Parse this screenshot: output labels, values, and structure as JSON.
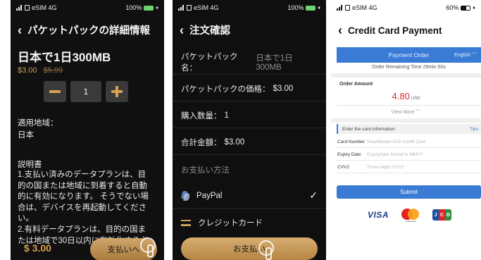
{
  "screen1": {
    "status": {
      "carrier": "eSIM 4G",
      "battery": "100%"
    },
    "header": {
      "title": "パケットパックの詳細情報"
    },
    "product": {
      "title": "日本で1日300MB",
      "price": "$3.00",
      "original_price": "$5.99"
    },
    "quantity": 1,
    "region_label": "適用地域：",
    "region_value": "日本",
    "description_label": "説明書",
    "description_lines": [
      "1.支払い済みのデータプランは、目",
      "的の国または地域に到着すると自動",
      "的に有効になります。 そうでない場",
      "合は、デバイスを再起動してくださ",
      "い。",
      "2.有料データプランは、目的の国ま",
      "たは地域で30日以内に有効化する必"
    ],
    "footer": {
      "total": "$ 3.00",
      "pay_button": "支払いへ"
    }
  },
  "screen2": {
    "status": {
      "carrier": "eSIM 4G",
      "battery": "100%"
    },
    "header": {
      "title": "注文確認"
    },
    "rows": [
      {
        "label": "パケットパック名：",
        "value": "日本で1日300MB"
      },
      {
        "label": "パケットパックの価格：",
        "value": "$3.00"
      },
      {
        "label": "購入数量：",
        "value": "1"
      },
      {
        "label": "合計金額：",
        "value": "$3.00"
      }
    ],
    "payment_section_title": "お支払い方法",
    "payment_methods": [
      {
        "label": "PayPal",
        "icon": "paypal-icon",
        "selected": true
      },
      {
        "label": "クレジットカード",
        "icon": "card-icon",
        "selected": false
      }
    ],
    "pay_button": "お支払い"
  },
  "screen3": {
    "status": {
      "carrier": "eSIM 4G",
      "battery": "60%"
    },
    "header": {
      "title": "Credit Card Payment"
    },
    "payment_order": {
      "title": "Payment Order",
      "language": "English"
    },
    "remaining_time": "Order Remaining Time 29min 50s",
    "order_amount": {
      "label": "Order Amount",
      "value": "4.80",
      "currency": "USD"
    },
    "view_more": "View More",
    "card_section": {
      "title": "Enter the card information",
      "tips": "Tips"
    },
    "fields": [
      {
        "label": "Card Number",
        "placeholder": "Visa/Master/JCB Credit Card"
      },
      {
        "label": "Expiry Date",
        "placeholder": "ExpiryDate format is MMYY"
      },
      {
        "label": "CVV2",
        "placeholder": "Three digits CVV2"
      }
    ],
    "submit_button": "Submit",
    "card_brands": {
      "visa": "VISA",
      "mastercard": "mastercard",
      "jcb": [
        "J",
        "C",
        "B"
      ]
    }
  },
  "colors": {
    "gold_accent": "#d9a253",
    "dark_bg": "#101010",
    "blue_accent": "#3a7bd5",
    "amount_red": "#d92a2a"
  }
}
